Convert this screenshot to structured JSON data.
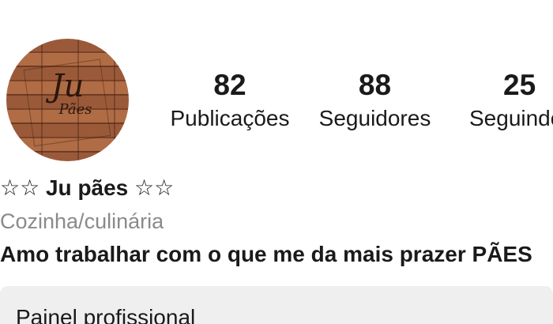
{
  "profile": {
    "avatar_text_main": "Ju",
    "avatar_text_sub": "Pães",
    "stats": {
      "posts": {
        "count": "82",
        "label": "Publicações"
      },
      "followers": {
        "count": "88",
        "label": "Seguidores"
      },
      "following": {
        "count": "25",
        "label": "Seguindo"
      }
    },
    "name": "☆☆ Ju pães ☆☆",
    "category": "Cozinha/culinária",
    "bio": "Amo trabalhar com o que me da mais prazer PÃES"
  },
  "professional_panel": {
    "label": "Painel profissional"
  },
  "colors": {
    "text_primary": "#1a1a1a",
    "text_secondary": "#8a8a8a",
    "panel_bg": "#efefef"
  }
}
